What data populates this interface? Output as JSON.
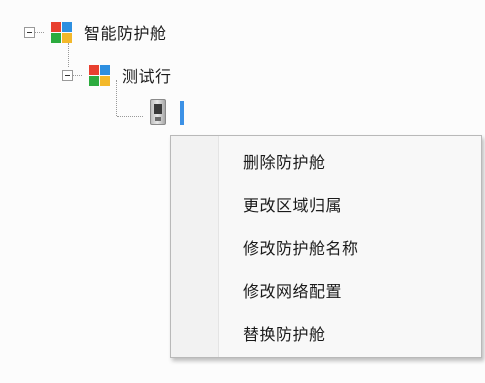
{
  "tree": {
    "root": {
      "label": "智能防护舱",
      "icon": "app-grid-icon",
      "expanded": true
    },
    "child": {
      "label": "测试行",
      "icon": "app-grid-icon",
      "expanded": true
    },
    "leaf": {
      "icon": "cabin-device-icon",
      "label": ""
    }
  },
  "icon_colors": {
    "red": "#e8402f",
    "blue": "#2e8fe0",
    "green": "#2cab3e",
    "yellow": "#f3b82a"
  },
  "context_menu": {
    "items": [
      {
        "label": "删除防护舱"
      },
      {
        "label": "更改区域归属"
      },
      {
        "label": "修改防护舱名称"
      },
      {
        "label": "修改网络配置"
      },
      {
        "label": "替换防护舱"
      }
    ]
  }
}
